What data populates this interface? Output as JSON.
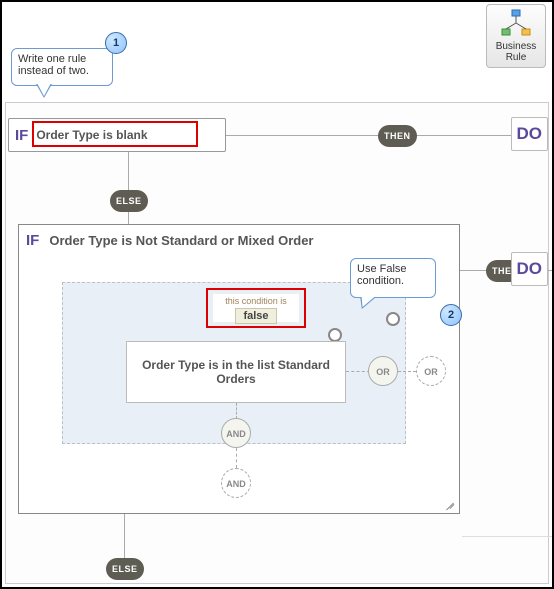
{
  "toolbar": {
    "business_rule": {
      "label": "Business Rule",
      "icon": "flowchart-icon"
    }
  },
  "callouts": {
    "one": {
      "num": "1",
      "text": "Write one rule instead of two."
    },
    "two": {
      "num": "2",
      "text": "Use False condition."
    }
  },
  "rule1": {
    "if_label": "IF",
    "condition": "Order Type is blank",
    "then_label": "THEN",
    "do_label": "DO",
    "else_label": "ELSE"
  },
  "rule2": {
    "if_label": "IF",
    "condition": "Order Type is Not Standard or Mixed Order",
    "then_label": "THEN",
    "do_label": "DO",
    "else_label": "ELSE",
    "false_chip": {
      "caption": "this condition is",
      "value": "false"
    },
    "inner_condition": "Order Type is in the list Standard Orders",
    "or_label": "OR",
    "and_label": "AND"
  }
}
